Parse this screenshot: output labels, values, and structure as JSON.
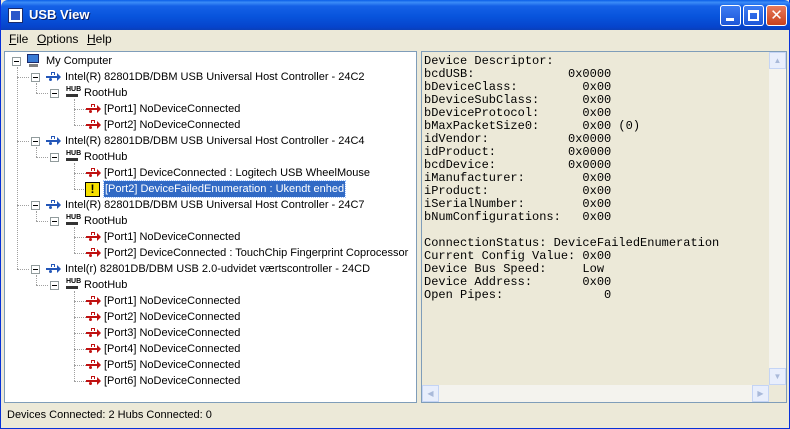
{
  "window": {
    "title": "USB View"
  },
  "menu": {
    "file": "File",
    "options": "Options",
    "help": "Help"
  },
  "tree": {
    "root": "My Computer",
    "controllers": [
      {
        "label": "Intel(R) 82801DB/DBM USB Universal Host Controller - 24C2",
        "hub": "RootHub",
        "ports": [
          "[Port1] NoDeviceConnected",
          "[Port2] NoDeviceConnected"
        ]
      },
      {
        "label": "Intel(R) 82801DB/DBM USB Universal Host Controller - 24C4",
        "hub": "RootHub",
        "ports": [
          "[Port1] DeviceConnected :  Logitech USB WheelMouse",
          "[Port2] DeviceFailedEnumeration :  Ukendt enhed"
        ]
      },
      {
        "label": "Intel(R) 82801DB/DBM USB Universal Host Controller - 24C7",
        "hub": "RootHub",
        "ports": [
          "[Port1] NoDeviceConnected",
          "[Port2] DeviceConnected :  TouchChip Fingerprint Coprocessor"
        ]
      },
      {
        "label": "Intel(r) 82801DB/DBM USB 2.0-udvidet værtscontroller - 24CD",
        "hub": "RootHub",
        "ports": [
          "[Port1] NoDeviceConnected",
          "[Port2] NoDeviceConnected",
          "[Port3] NoDeviceConnected",
          "[Port4] NoDeviceConnected",
          "[Port5] NoDeviceConnected",
          "[Port6] NoDeviceConnected"
        ]
      }
    ]
  },
  "details": {
    "lines": [
      "Device Descriptor:",
      "bcdUSB:             0x0000",
      "bDeviceClass:         0x00",
      "bDeviceSubClass:      0x00",
      "bDeviceProtocol:      0x00",
      "bMaxPacketSize0:      0x00 (0)",
      "idVendor:           0x0000",
      "idProduct:          0x0000",
      "bcdDevice:          0x0000",
      "iManufacturer:        0x00",
      "iProduct:             0x00",
      "iSerialNumber:        0x00",
      "bNumConfigurations:   0x00",
      "",
      "ConnectionStatus: DeviceFailedEnumeration",
      "Current Config Value: 0x00",
      "Device Bus Speed:     Low",
      "Device Address:       0x00",
      "Open Pipes:              0"
    ]
  },
  "status": {
    "text": "Devices Connected: 2   Hubs Connected: 0"
  }
}
